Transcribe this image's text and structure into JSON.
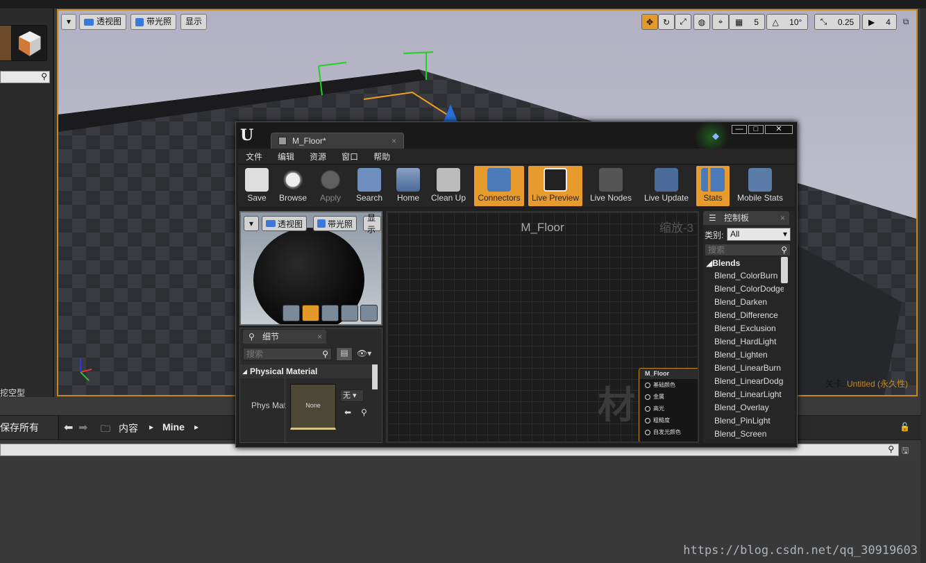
{
  "left_panel": {
    "bottom_text": "挖空型"
  },
  "viewport": {
    "buttons": [
      "透视图",
      "带光照",
      "显示"
    ],
    "snap": {
      "grid": "5",
      "rotation": "10°",
      "scale": "0.25",
      "camera_speed": "4"
    },
    "level_label": "关卡:",
    "level_name": "Untitled (永久性)"
  },
  "content_browser": {
    "save_all": "保存所有",
    "path": [
      "内容",
      "Mine"
    ]
  },
  "material_editor": {
    "tab_title": "M_Floor*",
    "menu": [
      "文件",
      "编辑",
      "资源",
      "窗口",
      "帮助"
    ],
    "toolbar": [
      {
        "label": "Save",
        "icon": "save-icon",
        "active": false
      },
      {
        "label": "Browse",
        "icon": "browse-icon",
        "active": false
      },
      {
        "label": "Apply",
        "icon": "apply-icon",
        "active": false
      },
      {
        "label": "Search",
        "icon": "search-icon",
        "active": false
      },
      {
        "label": "Home",
        "icon": "home-icon",
        "active": false
      },
      {
        "label": "Clean Up",
        "icon": "clean-up-icon",
        "active": false
      },
      {
        "label": "Connectors",
        "icon": "connectors-icon",
        "active": true
      },
      {
        "label": "Live Preview",
        "icon": "live-preview-icon",
        "active": true
      },
      {
        "label": "Live Nodes",
        "icon": "live-nodes-icon",
        "active": false
      },
      {
        "label": "Live Update",
        "icon": "live-update-icon",
        "active": false
      },
      {
        "label": "Stats",
        "icon": "stats-icon",
        "active": true
      },
      {
        "label": "Mobile Stats",
        "icon": "mobile-stats-icon",
        "active": false
      }
    ],
    "preview": {
      "buttons": [
        "透视图",
        "带光照",
        "显示"
      ]
    },
    "details": {
      "tab": "细节",
      "search_placeholder": "搜索",
      "section": "Physical Material",
      "phys_mat_label": "Phys Mat",
      "thumb_text": "None",
      "dropdown": "无"
    },
    "graph": {
      "title": "M_Floor",
      "zoom": "缩放-3",
      "watermark": "材质",
      "node": {
        "title": "M_Floor",
        "pins": [
          "基础颜色",
          "金属",
          "高光",
          "粗糙度",
          "自发光颜色"
        ]
      }
    },
    "palette": {
      "tab": "控制板",
      "category_label": "类别:",
      "category_value": "All",
      "search_placeholder": "搜索",
      "group": "Blends",
      "items": [
        "Blend_ColorBurn",
        "Blend_ColorDodge",
        "Blend_Darken",
        "Blend_Difference",
        "Blend_Exclusion",
        "Blend_HardLight",
        "Blend_Lighten",
        "Blend_LinearBurn",
        "Blend_LinearDodge",
        "Blend_LinearLight",
        "Blend_Overlay",
        "Blend_PinLight",
        "Blend_Screen"
      ]
    }
  },
  "watermark": "https://blog.csdn.net/qq_30919603",
  "colors": {
    "accent": "#e89b2d",
    "viewport_border": "#c8891c"
  }
}
